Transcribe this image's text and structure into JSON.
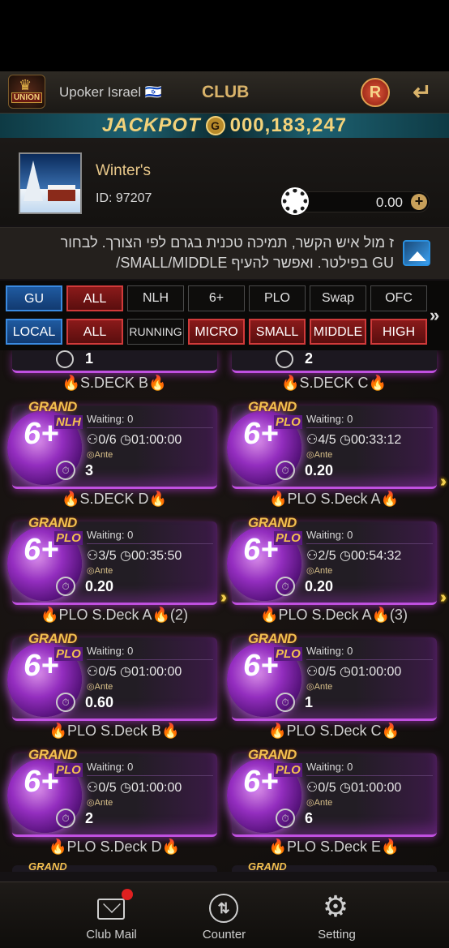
{
  "header": {
    "club_name": "Upoker Israel 🇮🇱",
    "title": "CLUB",
    "logo_text": "UNION",
    "r_button": "R",
    "back_icon": "back-arrow-icon"
  },
  "jackpot": {
    "label": "JACKPOT",
    "coin": "G",
    "value": "000,183,247"
  },
  "profile": {
    "name": "Winter's",
    "id": "ID: 97207",
    "balance": "0.00",
    "plus": "+"
  },
  "notice": {
    "text": "ז מול איש הקשר, תמיכה טכנית בגרם לפי הצורך. לבחור",
    "text2": "GU בפילטר. ואפשר להעיף SMALL/MIDDLE/"
  },
  "filters": {
    "row1": [
      "GU",
      "ALL",
      "NLH",
      "6+",
      "PLO",
      "Swap",
      "OFC"
    ],
    "row2": [
      "LOCAL",
      "ALL",
      "RUNNING",
      "MICRO",
      "SMALL",
      "MIDDLE",
      "HIGH"
    ],
    "more": "»"
  },
  "top_partial": [
    {
      "value": "1"
    },
    {
      "value": "2"
    }
  ],
  "tables": [
    {
      "name": "🔥S.DECK  B🔥",
      "game": "NLH",
      "waiting": "Waiting: 0",
      "players": "0/6",
      "time": "01:00:00",
      "ante": "Ante",
      "blind": "3",
      "running": false
    },
    {
      "name": "🔥S.DECK  C🔥",
      "game": "PLO",
      "waiting": "Waiting: 0",
      "players": "4/5",
      "time": "00:33:12",
      "ante": "Ante",
      "blind": "0.20",
      "running": true
    },
    {
      "name": "🔥S.DECK  D🔥",
      "game": "PLO",
      "waiting": "Waiting: 0",
      "players": "3/5",
      "time": "00:35:50",
      "ante": "Ante",
      "blind": "0.20",
      "running": true
    },
    {
      "name": "🔥PLO S.Deck A🔥",
      "game": "PLO",
      "waiting": "Waiting: 0",
      "players": "2/5",
      "time": "00:54:32",
      "ante": "Ante",
      "blind": "0.20",
      "running": true
    },
    {
      "name": "🔥PLO S.Deck A🔥(2)",
      "game": "PLO",
      "waiting": "Waiting: 0",
      "players": "0/5",
      "time": "01:00:00",
      "ante": "Ante",
      "blind": "0.60",
      "running": false
    },
    {
      "name": "🔥PLO S.Deck A🔥(3)",
      "game": "PLO",
      "waiting": "Waiting: 0",
      "players": "0/5",
      "time": "01:00:00",
      "ante": "Ante",
      "blind": "1",
      "running": false
    },
    {
      "name": "🔥PLO S.Deck B🔥",
      "game": "PLO",
      "waiting": "Waiting: 0",
      "players": "0/5",
      "time": "01:00:00",
      "ante": "Ante",
      "blind": "2",
      "running": false
    },
    {
      "name": "🔥PLO S.Deck C🔥",
      "game": "PLO",
      "waiting": "Waiting: 0",
      "players": "0/5",
      "time": "01:00:00",
      "ante": "Ante",
      "blind": "6",
      "running": false
    }
  ],
  "bottom_names": [
    "🔥PLO S.Deck D🔥",
    "🔥PLO S.Deck E🔥"
  ],
  "card_brand": {
    "grand": "GRAND",
    "six": "6+"
  },
  "nav": [
    {
      "label": "Club Mail",
      "icon": "mail-icon"
    },
    {
      "label": "Counter",
      "icon": "counter-icon"
    },
    {
      "label": "Setting",
      "icon": "gear-icon"
    }
  ],
  "colors": {
    "accent_gold": "#d9b36a",
    "filter_blue": "#1f5aa0",
    "filter_red": "#8a1a1a",
    "card_glow": "#c050e0"
  }
}
